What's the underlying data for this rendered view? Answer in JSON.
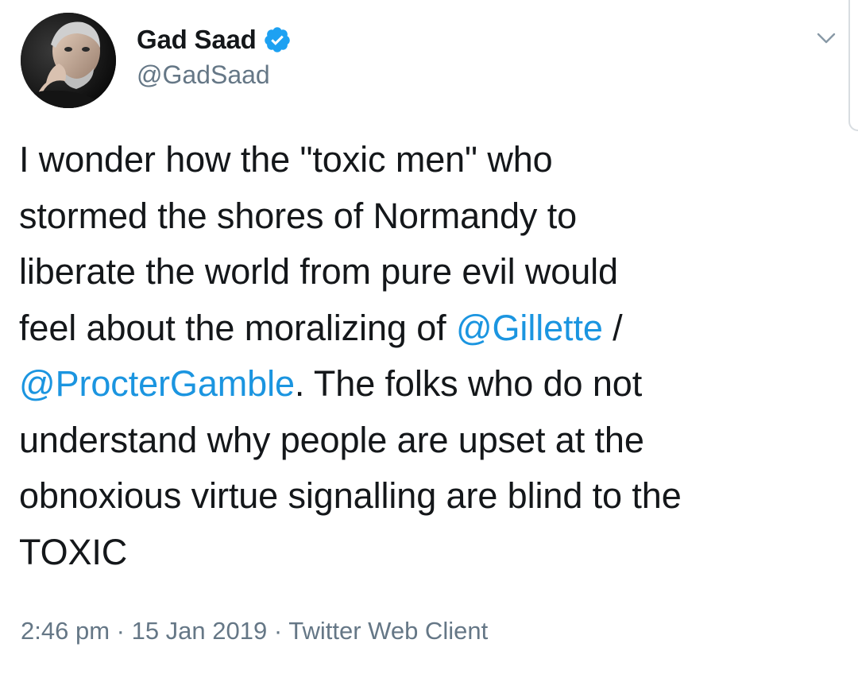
{
  "author": {
    "display_name": "Gad Saad",
    "handle": "@GadSaad",
    "verified": true,
    "avatar_icon": "profile-photo"
  },
  "menu": {
    "caret_icon": "chevron-down-icon"
  },
  "tweet": {
    "lines": [
      {
        "parts": [
          "I wonder how the \"toxic men\" who"
        ]
      },
      {
        "parts": [
          "stormed the shores of Normandy to"
        ]
      },
      {
        "parts": [
          "liberate the world from pure evil would"
        ]
      },
      {
        "text_before": "feel about the moralizing of ",
        "mention": "@Gillette",
        "text_after": " /"
      },
      {
        "mention": "@ProcterGamble",
        "text_after": ". The folks who do not"
      },
      {
        "parts": [
          "understand why people are upset at the"
        ]
      },
      {
        "parts": [
          "obnoxious virtue signalling are blind to the"
        ]
      },
      {
        "parts": [
          "TOXIC"
        ]
      }
    ]
  },
  "meta": {
    "time": "2:46 pm",
    "separator": " · ",
    "date": "15 Jan 2019",
    "source": "Twitter Web Client"
  },
  "colors": {
    "text": "#14171a",
    "secondary": "#657786",
    "link": "#1b95e0",
    "verified": "#1da1f2"
  }
}
